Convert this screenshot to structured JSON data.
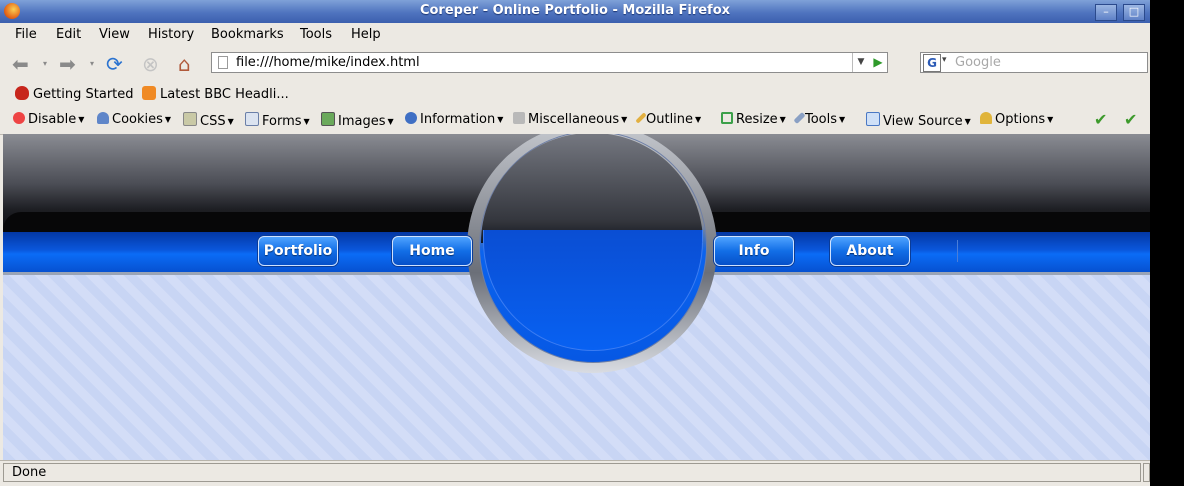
{
  "window": {
    "title": "Coreper - Online Portfolio - Mozilla Firefox"
  },
  "menubar": {
    "items": [
      "File",
      "Edit",
      "View",
      "History",
      "Bookmarks",
      "Tools",
      "Help"
    ]
  },
  "navbar": {
    "url": "file:///home/mike/index.html",
    "search_placeholder": "Google"
  },
  "bookmarks": {
    "items": [
      "Getting Started",
      "Latest BBC Headli..."
    ]
  },
  "devbar": {
    "items": [
      "Disable",
      "Cookies",
      "CSS",
      "Forms",
      "Images",
      "Information",
      "Miscellaneous",
      "Outline",
      "Resize",
      "Tools",
      "View Source",
      "Options"
    ]
  },
  "site": {
    "nav": [
      "Portfolio",
      "Home",
      "Info",
      "About"
    ]
  },
  "status": {
    "text": "Done"
  },
  "colors": {
    "accent": "#0b6cf6",
    "background": "#cfdaf6"
  }
}
